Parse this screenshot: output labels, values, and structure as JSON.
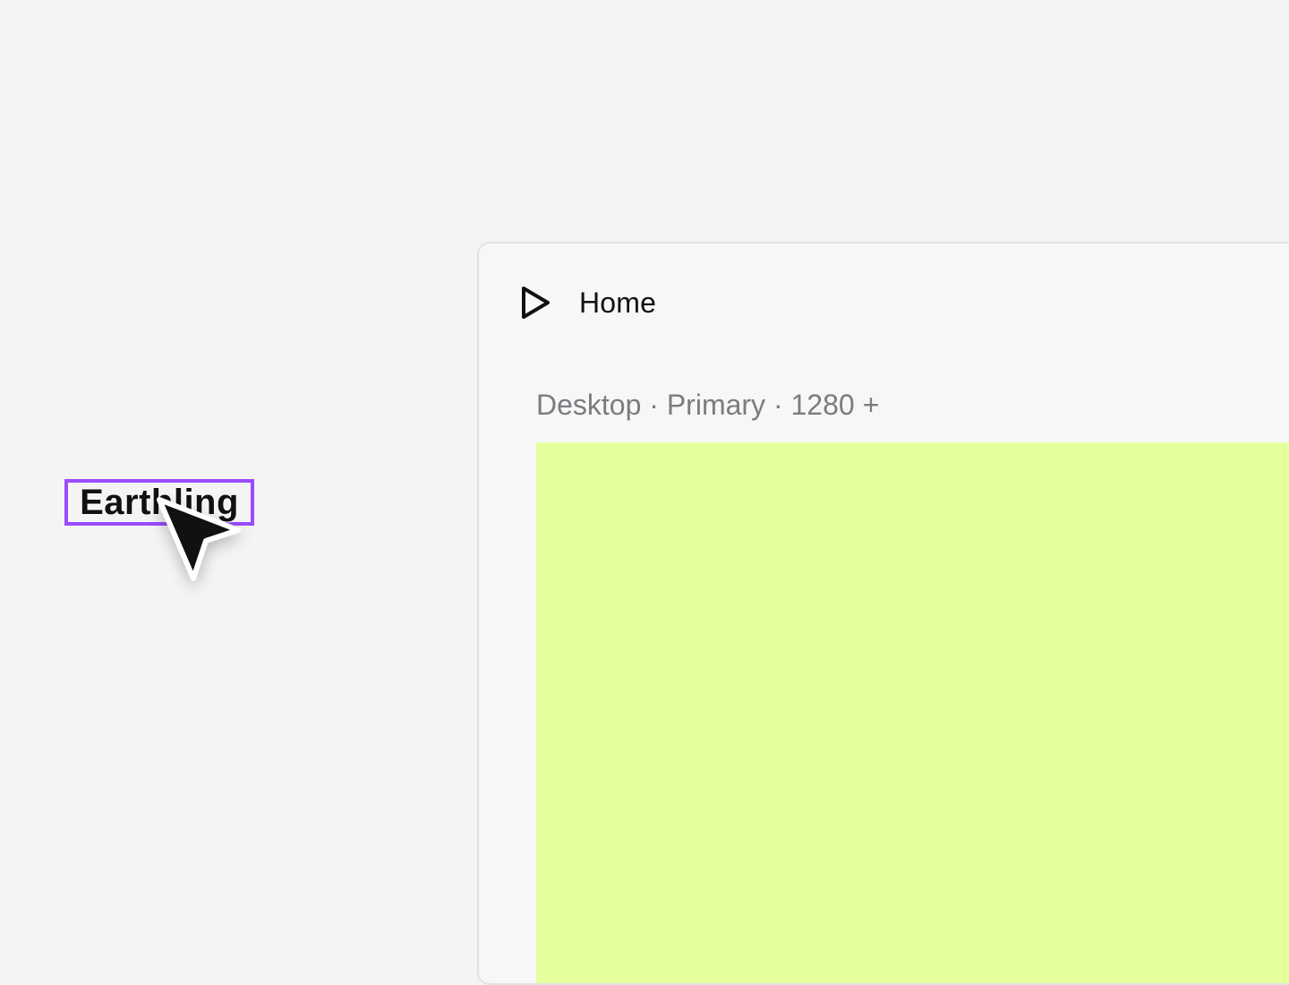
{
  "canvas": {
    "background": "#f4f4f5"
  },
  "frame_panel": {
    "title": "Home",
    "play_icon": "play-icon",
    "frame_label": "Desktop · Primary · 1280 +",
    "preview_color": "#e4ff9e"
  },
  "selected_text_layer": {
    "text": "Earthling",
    "selection_color": "#9b4cff"
  },
  "cursor": {
    "icon": "cursor-arrow-icon"
  }
}
